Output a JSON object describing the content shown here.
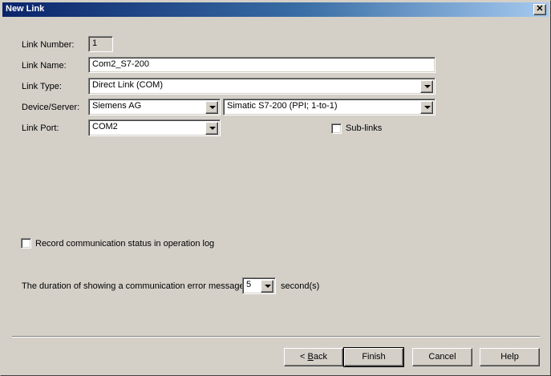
{
  "window": {
    "title": "New Link"
  },
  "form": {
    "link_number": {
      "label": "Link Number:",
      "value": "1"
    },
    "link_name": {
      "label": "Link Name:",
      "value": "Com2_S7-200"
    },
    "link_type": {
      "label": "Link Type:",
      "value": "Direct Link (COM)"
    },
    "device_server": {
      "label": "Device/Server:",
      "manufacturer": "Siemens AG",
      "device": "Simatic S7-200 (PPI; 1-to-1)"
    },
    "link_port": {
      "label": "Link Port:",
      "value": "COM2"
    },
    "sub_links": {
      "label": "Sub-links",
      "checked": false
    },
    "record_status": {
      "label": "Record communication status in operation log",
      "checked": false
    },
    "error_duration": {
      "label": "The duration of showing a communication error message:",
      "value": "5",
      "unit": "second(s)"
    }
  },
  "buttons": {
    "back_mnemonic": "B",
    "back_rest": "ack",
    "back_prefix": "< ",
    "finish": "Finish",
    "cancel": "Cancel",
    "help": "Help"
  }
}
